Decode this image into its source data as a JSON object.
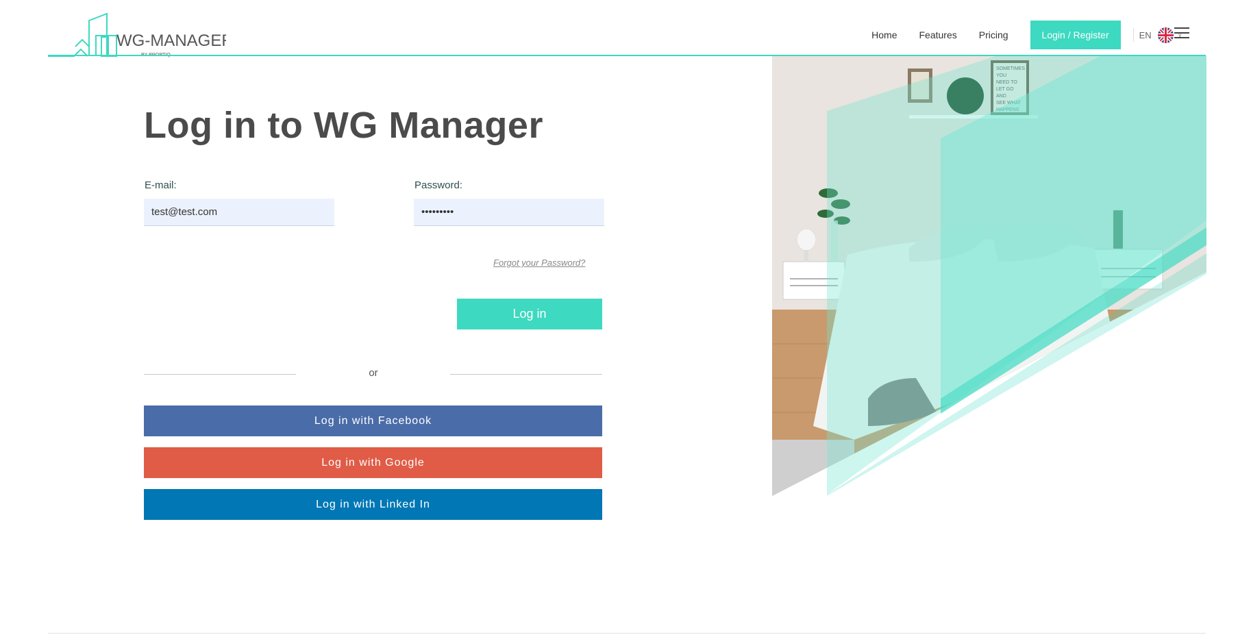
{
  "header": {
    "logo_text": "WG-MANAGER",
    "logo_sub": "BY PROPTIQ",
    "nav": [
      "Home",
      "Features",
      "Pricing"
    ],
    "cta": "Login / Register",
    "lang": "EN"
  },
  "main": {
    "title": "Log in to WG Manager",
    "email_label": "E-mail:",
    "email_value": "test@test.com",
    "password_label": "Password:",
    "password_value": "•••••••••",
    "forgot": "Forgot your Password?",
    "login_button": "Log in",
    "or": "or",
    "social": [
      {
        "label": "Log in with Facebook",
        "color": "#4a6ca8"
      },
      {
        "label": "Log in with Google",
        "color": "#e05c47"
      },
      {
        "label": "Log in with Linked In",
        "color": "#0177b5"
      }
    ]
  },
  "colors": {
    "accent": "#3dd9c1",
    "input_bg": "#ecf2fd"
  },
  "illustration": {
    "poster_lines": [
      "SOMETIMES",
      "YOU",
      "NEED TO",
      "LET GO",
      "AND",
      "SEE WHAT",
      "HAPPENS"
    ]
  }
}
